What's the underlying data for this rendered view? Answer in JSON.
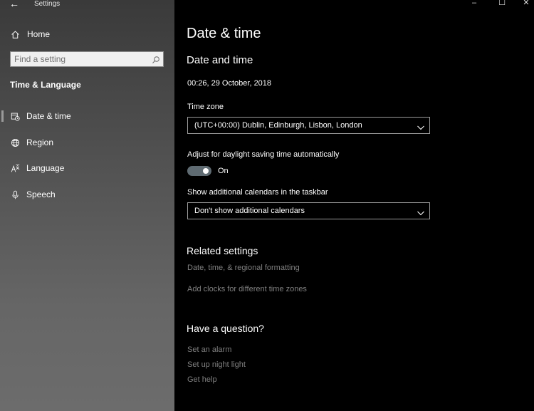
{
  "window": {
    "title": "Settings",
    "controls": {
      "minimize": "–",
      "maximize": "☐",
      "close": "✕"
    }
  },
  "sidebar": {
    "back": "←",
    "home_label": "Home",
    "search": {
      "placeholder": "Find a setting"
    },
    "section_title": "Time & Language",
    "items": [
      {
        "label": "Date & time",
        "icon": "calendar-clock-icon",
        "active": true
      },
      {
        "label": "Region",
        "icon": "globe-icon",
        "active": false
      },
      {
        "label": "Language",
        "icon": "language-icon",
        "active": false
      },
      {
        "label": "Speech",
        "icon": "microphone-icon",
        "active": false
      }
    ]
  },
  "main": {
    "page_title": "Date & time",
    "section_title": "Date and time",
    "current_datetime": "00:26, 29 October, 2018",
    "timezone": {
      "label": "Time zone",
      "value": "(UTC+00:00) Dublin, Edinburgh, Lisbon, London"
    },
    "dst": {
      "label": "Adjust for daylight saving time automatically",
      "state": "On",
      "enabled": true
    },
    "calendars": {
      "label": "Show additional calendars in the taskbar",
      "value": "Don't show additional calendars"
    },
    "related": {
      "title": "Related settings",
      "links": [
        "Date, time, & regional formatting",
        "Add clocks for different time zones"
      ]
    },
    "question": {
      "title": "Have a question?",
      "links": [
        "Set an alarm",
        "Set up night light",
        "Get help"
      ]
    }
  },
  "colors": {
    "sidebar_top": "#3a3a3a",
    "sidebar_bottom": "#6c6c6c",
    "toggle_on": "#5f6b72",
    "link": "#808080"
  }
}
